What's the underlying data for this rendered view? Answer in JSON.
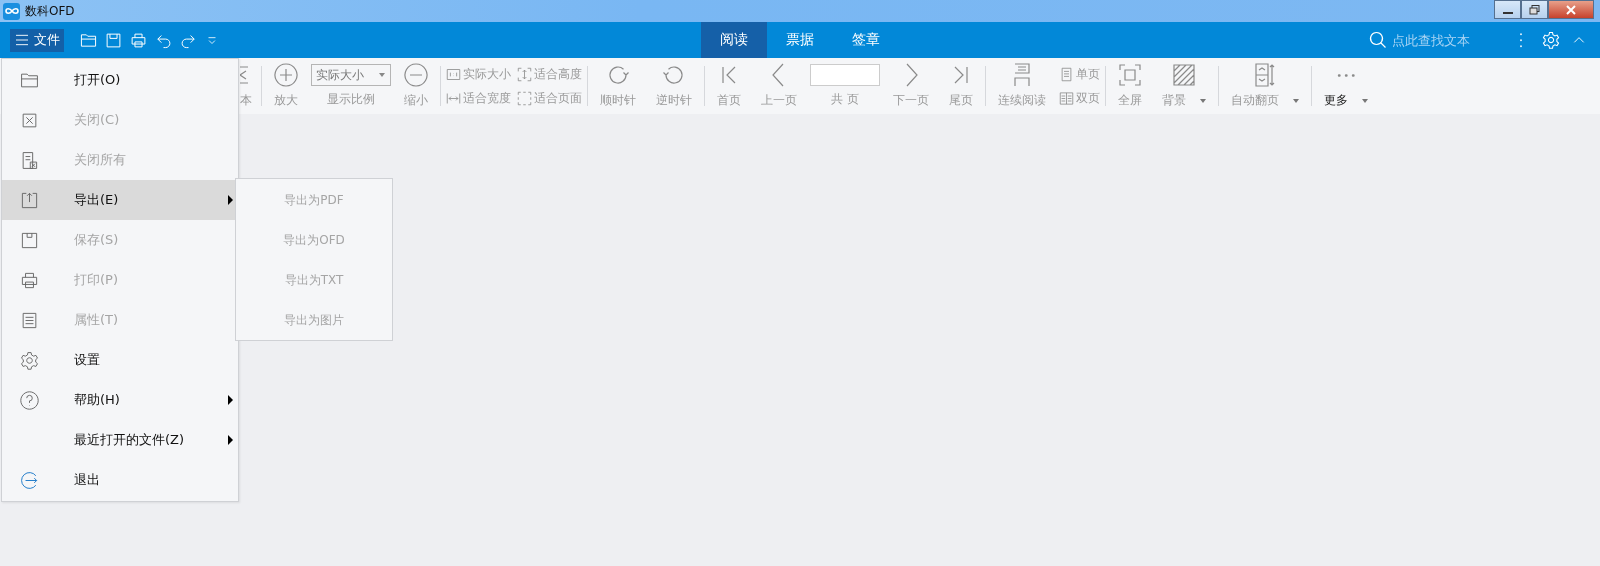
{
  "window": {
    "title": "数科OFD"
  },
  "top_bar": {
    "file_button": "文件",
    "tabs": [
      {
        "label": "阅读",
        "selected": true
      },
      {
        "label": "票据",
        "selected": false
      },
      {
        "label": "签章",
        "selected": false
      }
    ],
    "search": {
      "placeholder": "点此查找文本"
    }
  },
  "toolbar": {
    "groups": [
      [
        {
          "kind": "button",
          "label": "本",
          "disabled": true,
          "dropdown": false
        }
      ],
      [
        {
          "kind": "button",
          "label": "放大",
          "disabled": true,
          "dropdown": false
        },
        {
          "kind": "select",
          "value": "实际大小",
          "label": "显示比例",
          "disabled": true
        },
        {
          "kind": "button",
          "label": "缩小",
          "disabled": true,
          "dropdown": false
        }
      ],
      [
        {
          "kind": "stack",
          "items": [
            {
              "label": "实际大小",
              "disabled": true
            },
            {
              "label": "适合宽度",
              "disabled": true
            }
          ]
        },
        {
          "kind": "stack",
          "items": [
            {
              "label": "适合高度",
              "disabled": true
            },
            {
              "label": "适合页面",
              "disabled": true
            }
          ]
        }
      ],
      [
        {
          "kind": "button",
          "label": "顺时针",
          "disabled": true,
          "dropdown": false
        },
        {
          "kind": "button",
          "label": "逆时针",
          "disabled": true,
          "dropdown": false
        }
      ],
      [
        {
          "kind": "button",
          "label": "首页",
          "disabled": true,
          "dropdown": false
        },
        {
          "kind": "button",
          "label": "上一页",
          "disabled": true,
          "dropdown": false
        },
        {
          "kind": "page",
          "label": "共 页",
          "disabled": true
        },
        {
          "kind": "button",
          "label": "下一页",
          "disabled": true,
          "dropdown": false
        },
        {
          "kind": "button",
          "label": "尾页",
          "disabled": true,
          "dropdown": false
        }
      ],
      [
        {
          "kind": "button",
          "label": "连续阅读",
          "disabled": true,
          "dropdown": false
        },
        {
          "kind": "stack",
          "items": [
            {
              "label": "单页",
              "disabled": true
            },
            {
              "label": "双页",
              "disabled": true
            }
          ]
        }
      ],
      [
        {
          "kind": "button",
          "label": "全屏",
          "disabled": true,
          "dropdown": false
        },
        {
          "kind": "button",
          "label": "背景",
          "disabled": true,
          "dropdown": true
        }
      ],
      [
        {
          "kind": "button",
          "label": "自动翻页",
          "disabled": true,
          "dropdown": true
        }
      ],
      [
        {
          "kind": "button",
          "label": "更多",
          "disabled": false,
          "dropdown": true
        }
      ]
    ]
  },
  "file_menu": {
    "items": [
      {
        "label": "打开(O)",
        "disabled": false,
        "selected": false,
        "submenu": false
      },
      {
        "label": "关闭(C)",
        "disabled": true,
        "selected": false,
        "submenu": false
      },
      {
        "label": "关闭所有",
        "disabled": true,
        "selected": false,
        "submenu": false
      },
      {
        "label": "导出(E)",
        "disabled": false,
        "selected": true,
        "submenu": true
      },
      {
        "label": "保存(S)",
        "disabled": true,
        "selected": false,
        "submenu": false
      },
      {
        "label": "打印(P)",
        "disabled": true,
        "selected": false,
        "submenu": false
      },
      {
        "label": "属性(T)",
        "disabled": true,
        "selected": false,
        "submenu": false
      },
      {
        "label": "设置",
        "disabled": false,
        "selected": false,
        "submenu": false
      },
      {
        "label": "帮助(H)",
        "disabled": false,
        "selected": false,
        "submenu": true
      },
      {
        "label": "最近打开的文件(Z)",
        "disabled": false,
        "selected": false,
        "submenu": true
      },
      {
        "label": "退出",
        "disabled": false,
        "selected": false,
        "submenu": false
      }
    ]
  },
  "export_submenu": {
    "items": [
      {
        "label": "导出为PDF",
        "disabled": true
      },
      {
        "label": "导出为OFD",
        "disabled": true
      },
      {
        "label": "导出为TXT",
        "disabled": true
      },
      {
        "label": "导出为图片",
        "disabled": true
      }
    ]
  }
}
